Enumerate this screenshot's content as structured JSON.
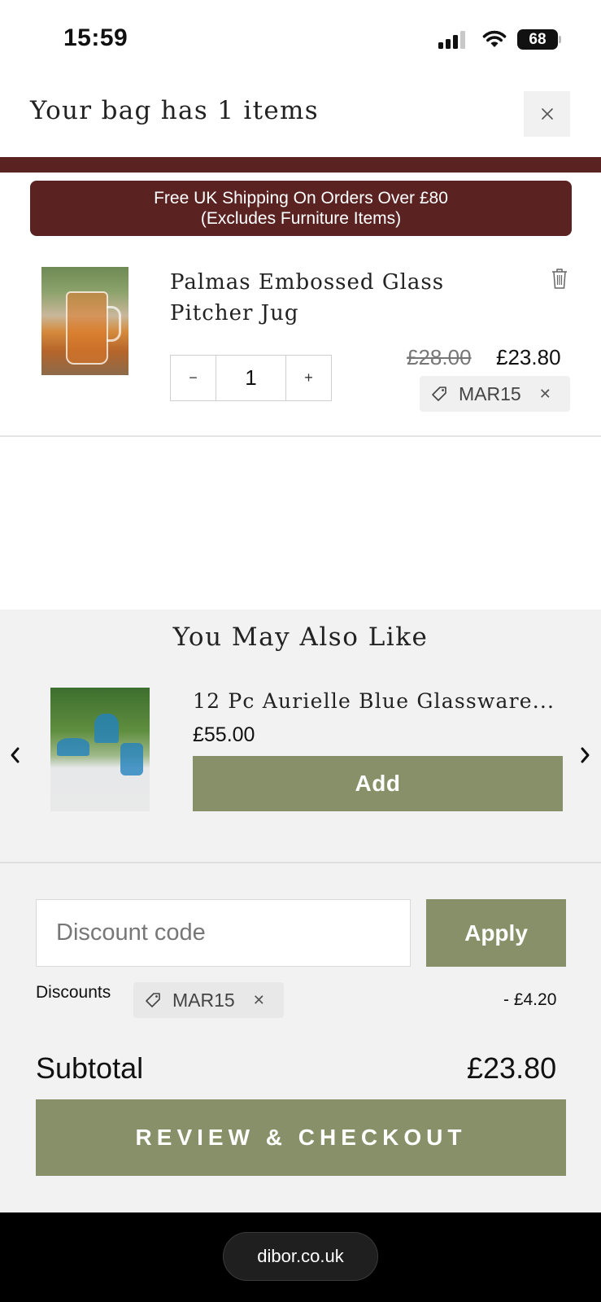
{
  "status_bar": {
    "time": "15:59",
    "battery": "68"
  },
  "cart": {
    "title": "Your bag has 1 items",
    "shipping_banner_line1": "Free UK Shipping On Orders Over £80",
    "shipping_banner_line2": "(Excludes Furniture Items)",
    "items": [
      {
        "name": "Palmas Embossed Glass Pitcher Jug",
        "quantity": "1",
        "original_price": "£28.00",
        "price": "£23.80",
        "discount_code": "MAR15",
        "decrement_label": "−",
        "increment_label": "+"
      }
    ]
  },
  "recommendations": {
    "title": "You May Also Like",
    "items": [
      {
        "name": "12 Pc Aurielle Blue Glassware...",
        "price": "£55.00",
        "add_label": "Add"
      }
    ]
  },
  "summary": {
    "discount_placeholder": "Discount code",
    "apply_label": "Apply",
    "discounts_label": "Discounts",
    "discount_code": "MAR15",
    "discount_amount": "- £4.20",
    "subtotal_label": "Subtotal",
    "subtotal_value": "£23.80",
    "checkout_label": "REVIEW & CHECKOUT"
  },
  "browser": {
    "url": "dibor.co.uk"
  },
  "colors": {
    "brand_maroon": "#5a2322",
    "accent_olive": "#889069"
  },
  "icons": [
    "close-icon",
    "trash-icon",
    "tag-icon",
    "chevron-left-icon",
    "chevron-right-icon",
    "wifi-icon",
    "signal-icon",
    "battery-icon"
  ]
}
